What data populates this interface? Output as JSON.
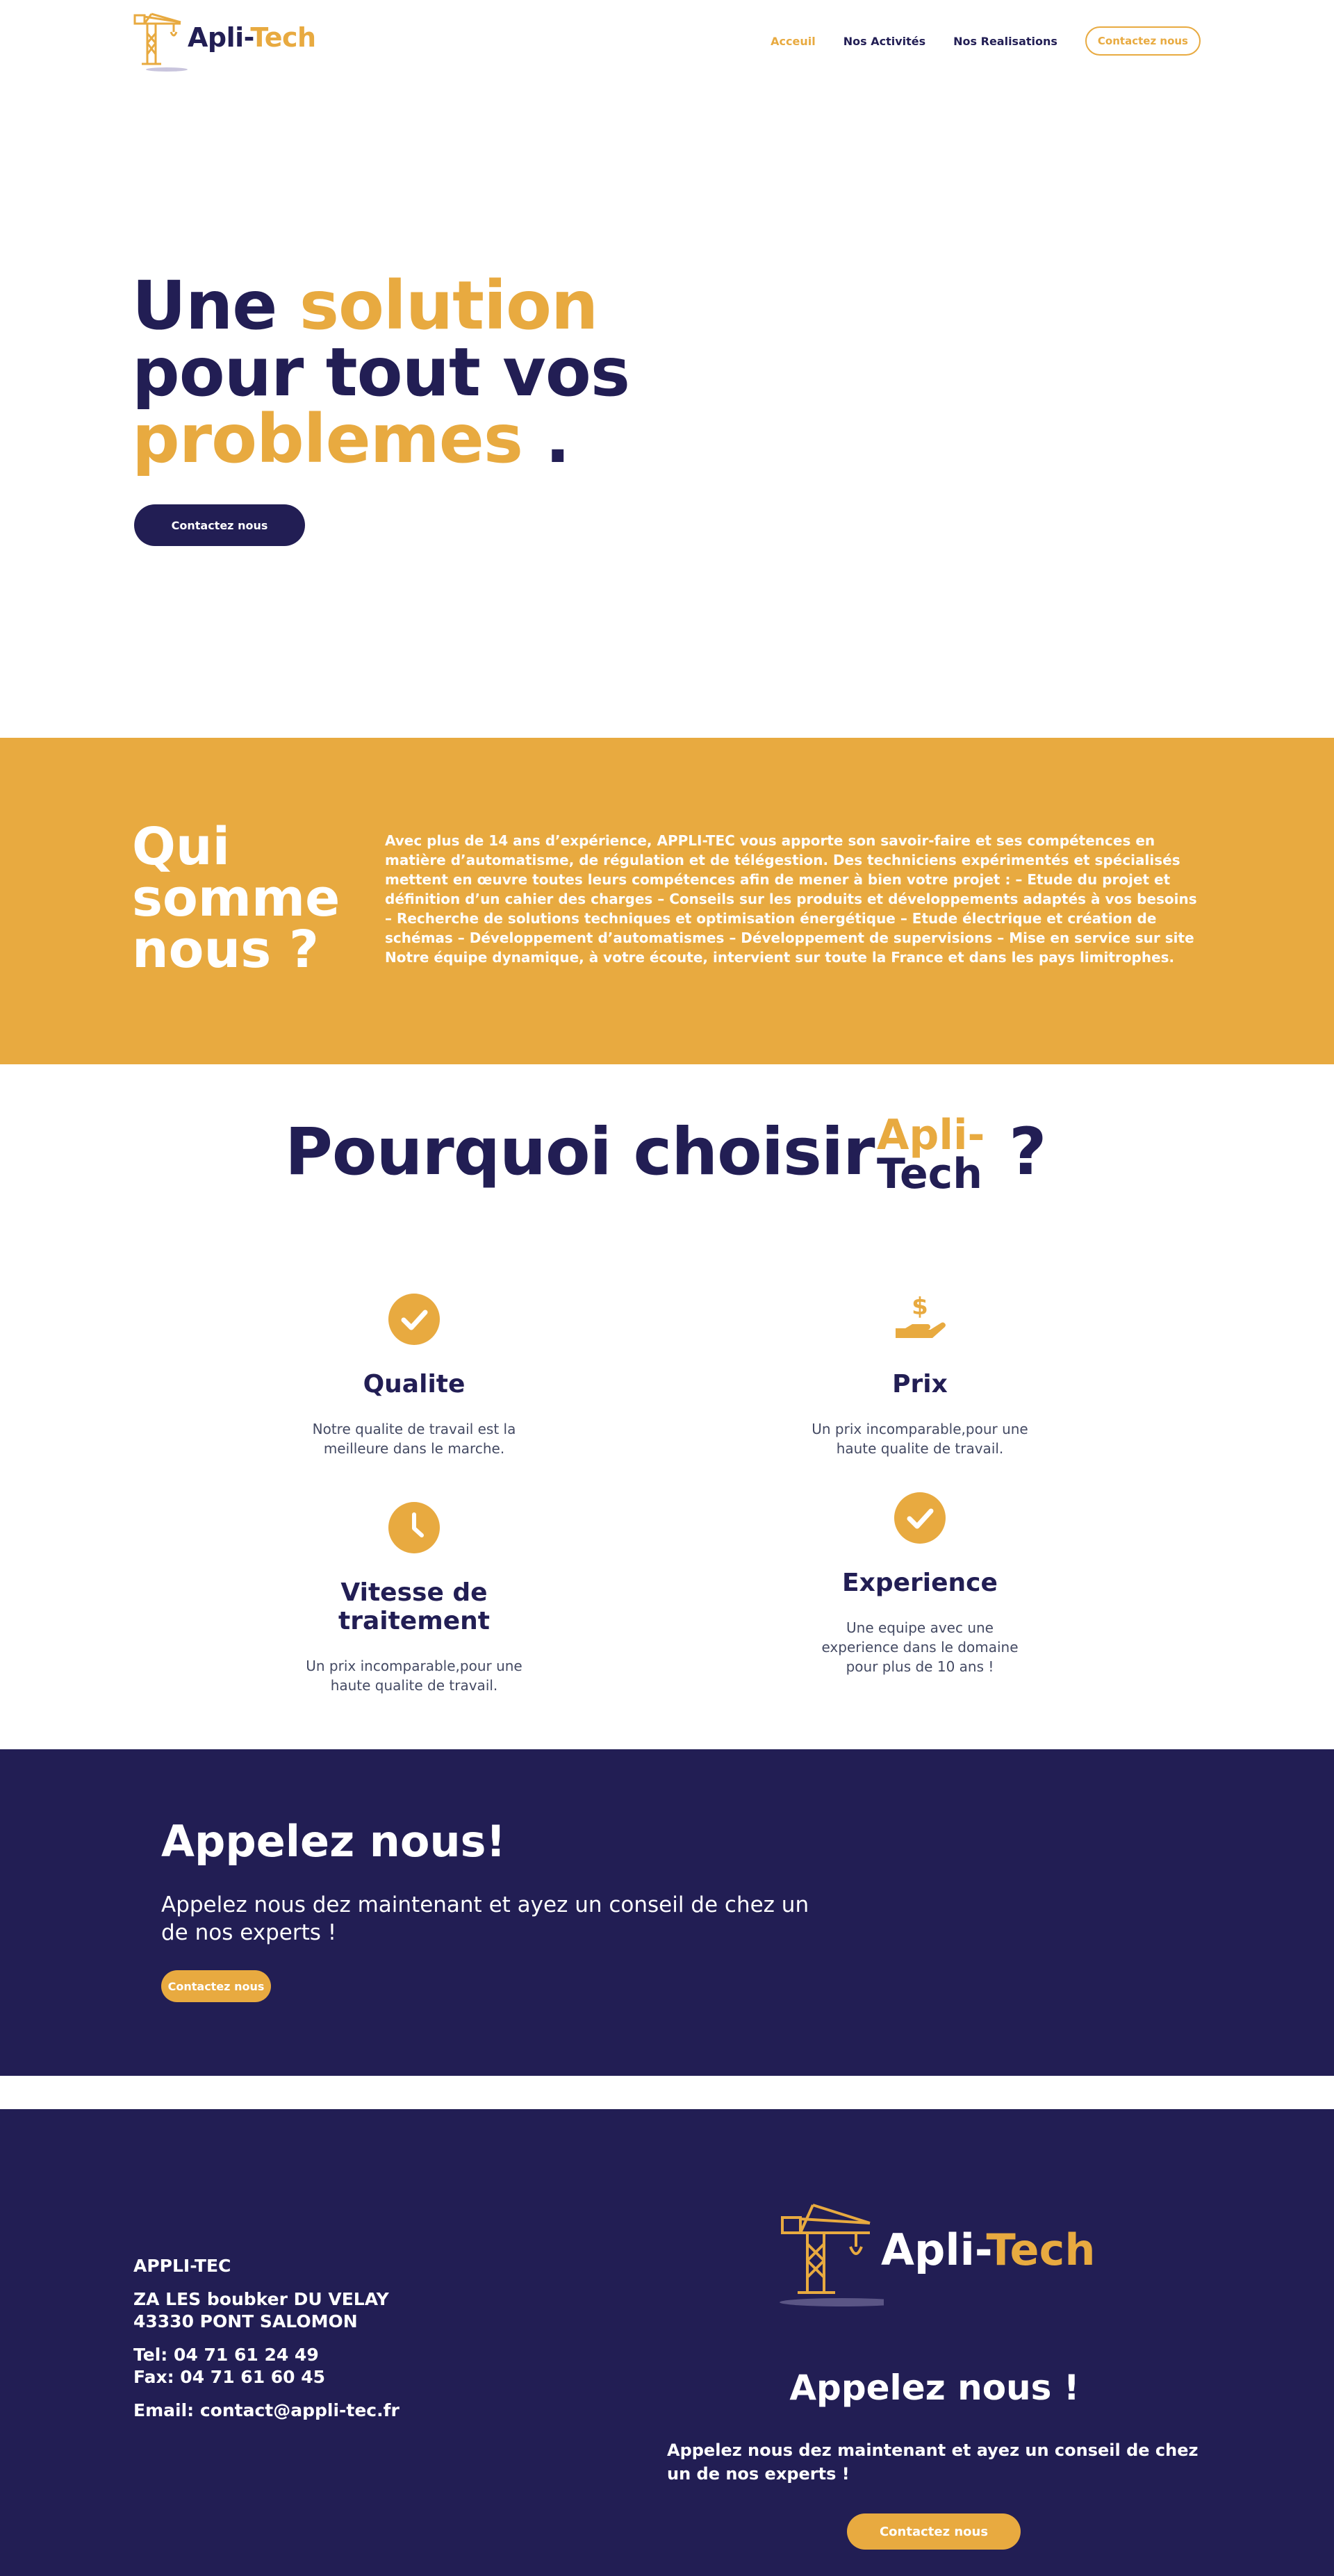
{
  "brand": {
    "name_part1": "Apli-",
    "name_part2": "Tech",
    "colors": {
      "navy": "#221e54",
      "yellow": "#e8aa40",
      "white": "#ffffff"
    },
    "logo_icon": "crane-icon"
  },
  "nav": {
    "items": [
      {
        "label": "Acceuil",
        "active": true
      },
      {
        "label": "Nos Activités",
        "active": false
      },
      {
        "label": "Nos Realisations",
        "active": false
      }
    ],
    "cta": "Contactez nous"
  },
  "hero": {
    "line1_a": "Une ",
    "line1_b": "solution",
    "line2": "pour tout vos",
    "line3_a": "problemes",
    "line3_b": " .",
    "button": "Contactez nous"
  },
  "about": {
    "title_l1": "Qui",
    "title_l2": "somme",
    "title_l3": "nous ?",
    "text": "Avec plus de 14 ans d’expérience, APPLI-TEC vous apporte son savoir-faire et ses compétences en matière d’automatisme, de régulation et de télégestion. Des techniciens expérimentés et spécialisés mettent en œuvre toutes leurs compétences afin de mener à bien votre projet : – Etude du projet et définition d’un cahier des charges – Conseils sur les produits et développements adaptés à vos besoins – Recherche de solutions techniques et optimisation énergétique – Etude électrique et création de schémas – Développement d’automatismes – Développement de supervisions – Mise en service sur site Notre équipe dynamique, à votre écoute, intervient sur toute la France et dans les pays limitrophes."
  },
  "why": {
    "title": "Pourquoi choisir",
    "logo_a": "Apli-",
    "logo_b": "Tech",
    "qmark": "?",
    "features": [
      {
        "icon": "check-circle-icon",
        "title": "Qualite",
        "text": "Notre qualite de travail est la meilleure dans le marche."
      },
      {
        "icon": "hand-dollar-icon",
        "title": "Prix",
        "text": "Un prix incomparable,pour une haute qualite de travail."
      },
      {
        "icon": "clock-icon",
        "title": "Vitesse de traitement",
        "text": "Un prix incomparable,pour une haute qualite de travail."
      },
      {
        "icon": "check-circle-icon",
        "title": "Experience",
        "text": "Une equipe avec une experience dans le domaine pour plus de 10 ans !"
      }
    ]
  },
  "call": {
    "title": "Appelez nous!",
    "text": "Appelez nous dez maintenant et ayez un conseil de chez un de nos experts !",
    "button": "Contactez nous"
  },
  "footer": {
    "company": "APPLI-TEC",
    "address_l1": "ZA LES boubker DU VELAY",
    "address_l2": "43330 PONT SALOMON",
    "tel": "Tel: 04 71 61 24 49",
    "fax": "Fax: 04 71 61 60 45",
    "email": "Email: contact@appli-tec.fr",
    "logo_part1": "Apli-",
    "logo_part2": "Tech",
    "call_title": "Appelez nous !",
    "call_text": "Appelez nous dez maintenant et ayez un conseil de chez un de nos experts !",
    "button": "Contactez nous"
  }
}
